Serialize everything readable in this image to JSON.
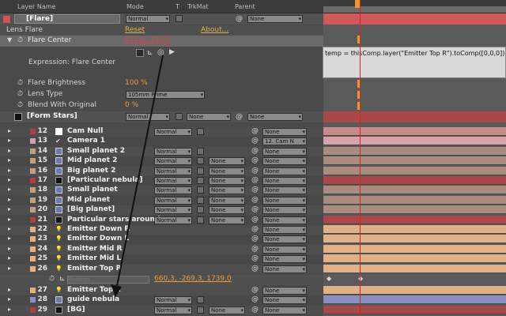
{
  "header": {
    "layer_name": "Layer Name",
    "mode": "Mode",
    "t": "T",
    "trkmat": "TrkMat",
    "parent": "Parent"
  },
  "flare": {
    "layer_name": "[Flare]",
    "mode": "Normal",
    "parent": "None"
  },
  "lens_flare": {
    "label": "Lens Flare",
    "reset": "Reset",
    "about": "About..."
  },
  "flare_center": {
    "label": "Flare Center",
    "value": "474,0, 230,0"
  },
  "expression": {
    "label": "Expression: Flare Center",
    "code": "temp = thisComp.layer(\"Emitter Top R\").toComp([0,0,0])"
  },
  "properties": {
    "brightness_label": "Flare Brightness",
    "brightness_value": "100 %",
    "lens_type_label": "Lens Type",
    "lens_type_value": "105mm Prime",
    "blend_label": "Blend With Original",
    "blend_value": "0 %"
  },
  "form_stars": {
    "layer_name": "[Form Stars]",
    "mode": "Normal",
    "trkmat": "None",
    "parent": "None"
  },
  "layers": [
    {
      "num": "12",
      "name": "Cam Null",
      "color": "#b04040",
      "icon": "square-white",
      "mode": "Normal",
      "trkmat": "",
      "parent": "None",
      "bar": "#c98a8a"
    },
    {
      "num": "13",
      "name": "Camera 1",
      "color": "#d4a0b0",
      "icon": "check",
      "mode": "",
      "trkmat": "",
      "parent": "12. Cam N",
      "bar": "#d9a2a8"
    },
    {
      "num": "14",
      "name": "Small planet 2",
      "color": "#c0a080",
      "icon": "comp",
      "mode": "Normal",
      "trkmat": "",
      "parent": "None",
      "bar": "#a88c7e"
    },
    {
      "num": "15",
      "name": "Mid planet 2",
      "color": "#c0a080",
      "icon": "comp",
      "mode": "Normal",
      "trkmat": "None",
      "parent": "None",
      "bar": "#a88c7e"
    },
    {
      "num": "16",
      "name": "Big planet 2",
      "color": "#c0a080",
      "icon": "comp",
      "mode": "Normal",
      "trkmat": "None",
      "parent": "None",
      "bar": "#a88c7e"
    },
    {
      "num": "17",
      "name": "[Particular nebula]",
      "color": "#b04040",
      "icon": "square-black",
      "mode": "Normal",
      "trkmat": "None",
      "parent": "None",
      "bar": "#a84848"
    },
    {
      "num": "18",
      "name": "Small planet",
      "color": "#c0a080",
      "icon": "comp",
      "mode": "Normal",
      "trkmat": "None",
      "parent": "None",
      "bar": "#a88c7e"
    },
    {
      "num": "19",
      "name": "Mid planet",
      "color": "#c0a080",
      "icon": "comp",
      "mode": "Normal",
      "trkmat": "None",
      "parent": "None",
      "bar": "#a88c7e"
    },
    {
      "num": "20",
      "name": "[Big planet]",
      "color": "#c0a080",
      "icon": "comp",
      "mode": "Normal",
      "trkmat": "None",
      "parent": "None",
      "bar": "#a88c7e"
    },
    {
      "num": "21",
      "name": "Particular stars around",
      "color": "#b04040",
      "icon": "square-black",
      "mode": "Normal",
      "trkmat": "None",
      "parent": "None",
      "bar": "#a84848"
    },
    {
      "num": "22",
      "name": "Emitter Down R",
      "color": "#e8b080",
      "icon": "bulb",
      "mode": "",
      "trkmat": "",
      "parent": "None",
      "bar": "#e0b088"
    },
    {
      "num": "23",
      "name": "Emitter Down L",
      "color": "#e8b080",
      "icon": "bulb",
      "mode": "",
      "trkmat": "",
      "parent": "None",
      "bar": "#e0b088"
    },
    {
      "num": "24",
      "name": "Emitter Mid R",
      "color": "#e8b080",
      "icon": "bulb",
      "mode": "",
      "trkmat": "",
      "parent": "None",
      "bar": "#e0b088"
    },
    {
      "num": "25",
      "name": "Emitter Mid L",
      "color": "#e8b080",
      "icon": "bulb",
      "mode": "",
      "trkmat": "",
      "parent": "None",
      "bar": "#e0b088"
    },
    {
      "num": "26",
      "name": "Emitter Top R",
      "color": "#e8b080",
      "icon": "bulb",
      "mode": "",
      "trkmat": "",
      "parent": "None",
      "bar": "#e0b088"
    }
  ],
  "position": {
    "placeholder": "Position",
    "value": "660,3, -269,3, 1739,0"
  },
  "layers_bottom": [
    {
      "num": "27",
      "name": "Emitter Top L",
      "color": "#e8b080",
      "icon": "bulb",
      "mode": "",
      "trkmat": "",
      "parent": "None",
      "bar": "#e0b088"
    },
    {
      "num": "28",
      "name": "guide nebula",
      "color": "#8890c8",
      "icon": "comp",
      "mode": "Normal",
      "trkmat": "",
      "parent": "None",
      "bar": "#8a8fc0"
    },
    {
      "num": "29",
      "name": "[BG]",
      "color": "#b04040",
      "icon": "square-black",
      "mode": "Normal",
      "trkmat": "None",
      "parent": "None",
      "bar": "#a84848"
    }
  ],
  "colors": {
    "accent_red": "#e24040",
    "value_orange": "#f09a3a",
    "link_yellow": "#e0b050"
  }
}
